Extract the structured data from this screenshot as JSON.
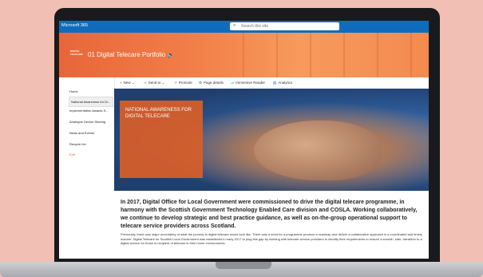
{
  "topbar": {
    "brand": "Microsoft 365",
    "search_placeholder": "Search this site"
  },
  "site": {
    "logo_text": "DIGITAL TELECARE",
    "title": "01 Digital Telecare Portfolio"
  },
  "commands": [
    {
      "label": "New",
      "icon": "plus-icon"
    },
    {
      "label": "Send to",
      "icon": "send-icon"
    },
    {
      "label": "Promote",
      "icon": "promote-icon"
    },
    {
      "label": "Page details",
      "icon": "settings-icon"
    },
    {
      "label": "Immersive Reader",
      "icon": "reader-icon"
    },
    {
      "label": "Analytics",
      "icon": "chart-icon"
    }
  ],
  "nav": {
    "items": [
      "Home",
      "National Awareness for Di...",
      "Implementation Awards S...",
      "Analogue Device Sharing",
      "News and Events",
      "Recycle bin",
      "Edit"
    ]
  },
  "hero": {
    "heading": "NATIONAL AWARENESS FOR DIGITAL TELECARE"
  },
  "content": {
    "lead": "In 2017, Digital Office for Local Government were commissioned to drive the digital telecare programme, in harmony with the Scottish Government Technology Enabled Care division and COSLA. Working collaboratively, we continue to develop strategic and best practice guidance, as well as on-the-group operational support to telecare service providers across Scotland.",
    "body": "Previously, there was major uncertainty of what the journey to digital telecare would look like. There was a need for a programme produce a roadmap and deliver a collaborative approach in a coordinated and timely manner. Digital Telecare for Scottish Local Government was established in early 2017 to plug this gap by working with telecare service providers to identify their requirements to ensure a smooth, safe, transition to a digital service for those in recipient of telecare in their home environments."
  },
  "colors": {
    "suite_bar": "#0f6cbd",
    "accent": "#e8663a",
    "background": "#f1bfb3"
  }
}
